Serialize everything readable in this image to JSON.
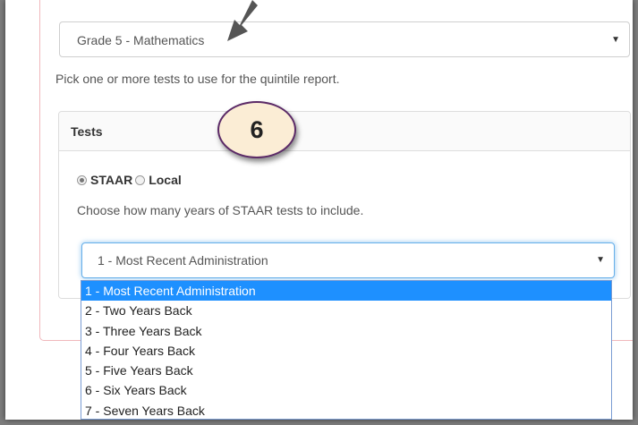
{
  "subject_select": {
    "value": "Grade 5 - Mathematics"
  },
  "help_text": "Pick one or more tests to use for the quintile report.",
  "tests_panel": {
    "title": "Tests",
    "radios": [
      {
        "label": "STAAR",
        "checked": true
      },
      {
        "label": "Local",
        "checked": false
      }
    ],
    "years_help": "Choose how many years of STAAR tests to include.",
    "years_select": {
      "value": "1 - Most Recent Administration",
      "options": [
        "1 - Most Recent Administration",
        "2 - Two Years Back",
        "3 - Three Years Back",
        "4 - Four Years Back",
        "5 - Five Years Back",
        "6 - Six Years Back",
        "7 - Seven Years Back"
      ],
      "highlighted_index": 0
    }
  },
  "callout": {
    "number": "6"
  },
  "colors": {
    "highlight": "#1e90ff",
    "focus_border": "#66afe9",
    "badge_fill": "#fbedd5",
    "badge_border": "#5b2a67",
    "card_border": "#f0b8bc"
  },
  "icons": {
    "select_caret": "caret-down-icon",
    "annotation_arrow": "arrow-icon"
  }
}
